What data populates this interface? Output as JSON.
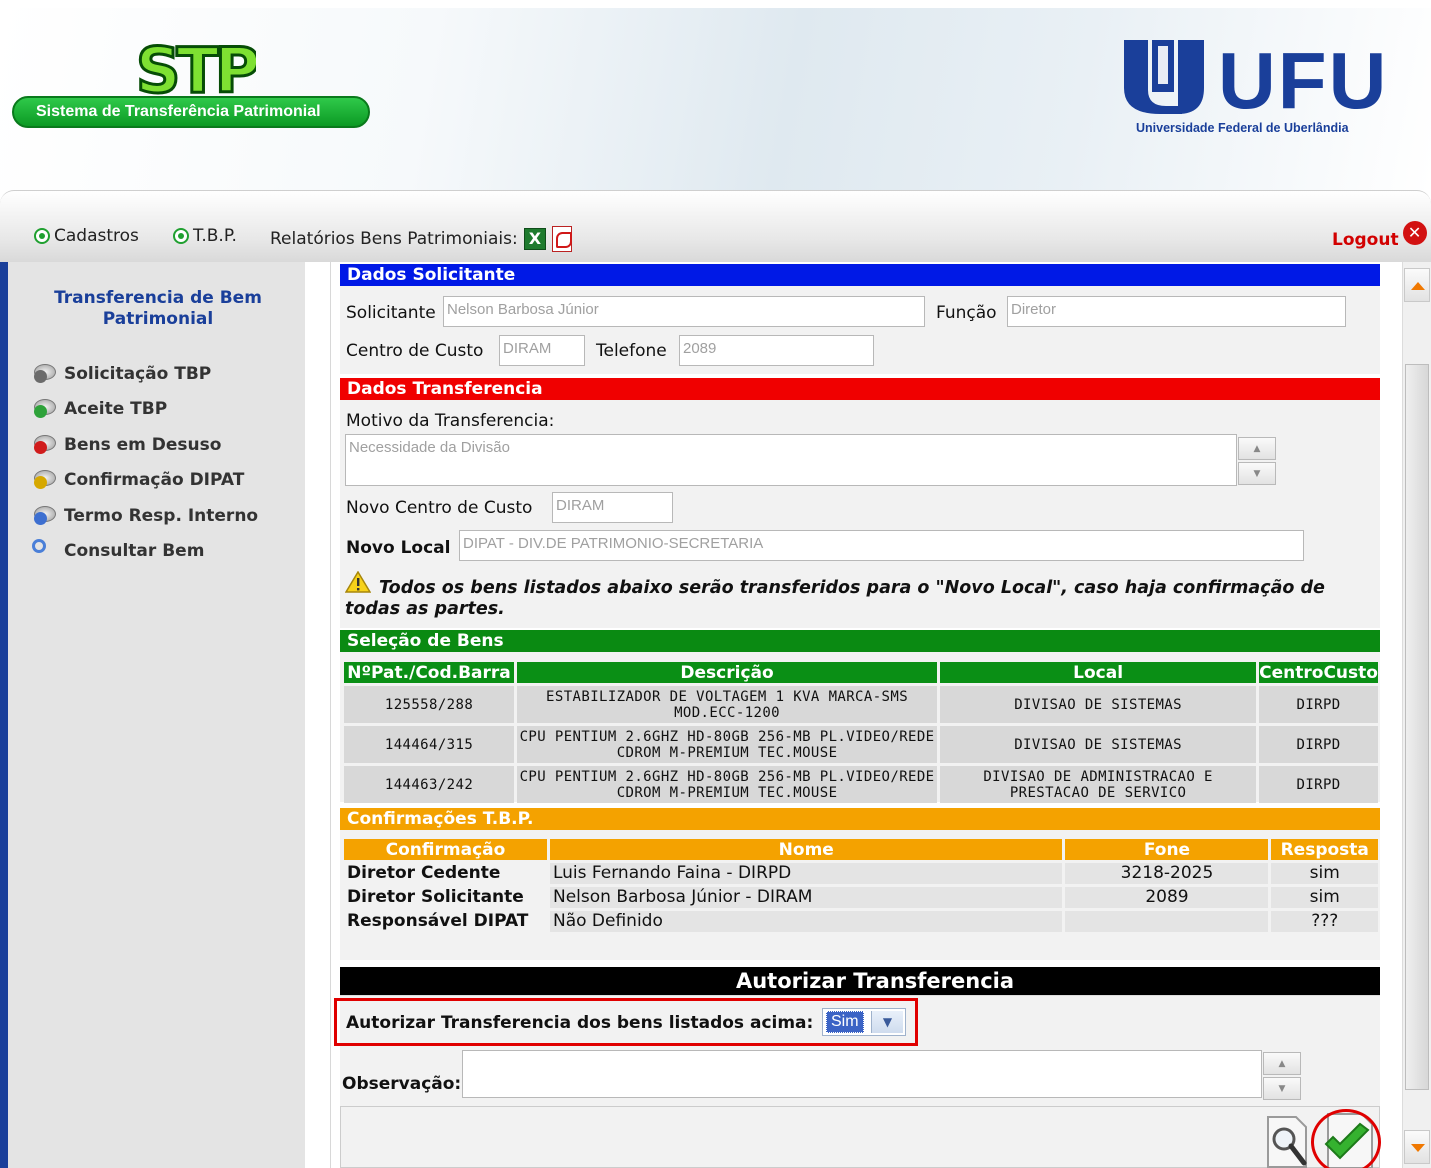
{
  "header": {
    "logo_text": "STP",
    "system_name": "Sistema de Transferência Patrimonial",
    "university_logo_text": "UFU",
    "university_name": "Universidade Federal de Uberlândia"
  },
  "menu": {
    "cadastros": "Cadastros",
    "tbp": "T.B.P.",
    "relatorios": "Relatórios Bens Patrimoniais:",
    "logout": "Logout",
    "icons": [
      "excel-icon",
      "pdf-icon",
      "close-icon"
    ]
  },
  "sidebar": {
    "title": "Transferencia de Bem Patrimonial",
    "items": [
      {
        "label": "Solicitação TBP",
        "badge_color": "#6b6b6b"
      },
      {
        "label": "Aceite TBP",
        "badge_color": "#2ea23a"
      },
      {
        "label": "Bens em Desuso",
        "badge_color": "#d01c1c"
      },
      {
        "label": "Confirmação DIPAT",
        "badge_color": "#d6a800"
      },
      {
        "label": "Termo Resp. Interno",
        "badge_color": "#3d6fd0"
      },
      {
        "label": "Consultar Bem",
        "badge_color": "#4a7fd8"
      }
    ]
  },
  "solicitante": {
    "section_title": "Dados Solicitante",
    "solicitante_label": "Solicitante",
    "solicitante_value": "Nelson Barbosa Júnior",
    "funcao_label": "Função",
    "funcao_value": "Diretor",
    "centro_label": "Centro de Custo",
    "centro_value": "DIRAM",
    "telefone_label": "Telefone",
    "telefone_value": "2089"
  },
  "transferencia": {
    "section_title": "Dados Transferencia",
    "motivo_label": "Motivo da Transferencia:",
    "motivo_value": "Necessidade da Divisão",
    "novo_centro_label": "Novo Centro de Custo",
    "novo_centro_value": "DIRAM",
    "novo_local_label": "Novo Local",
    "novo_local_value": "DIPAT - DIV.DE PATRIMONIO-SECRETARIA",
    "warning": "Todos os bens listados abaixo serão transferidos para o \"Novo Local\", caso haja confirmação de todas as partes."
  },
  "bens": {
    "section_title": "Seleção de Bens",
    "columns": [
      "NºPat./Cod.Barra",
      "Descrição",
      "Local",
      "CentroCusto"
    ],
    "rows": [
      [
        "125558/288",
        "ESTABILIZADOR DE VOLTAGEM 1 KVA MARCA-SMS MOD.ECC-1200",
        "DIVISAO DE SISTEMAS",
        "DIRPD"
      ],
      [
        "144464/315",
        "CPU PENTIUM 2.6GHZ HD-80GB 256-MB PL.VIDEO/REDE CDROM M-PREMIUM TEC.MOUSE",
        "DIVISAO DE SISTEMAS",
        "DIRPD"
      ],
      [
        "144463/242",
        "CPU PENTIUM 2.6GHZ HD-80GB 256-MB PL.VIDEO/REDE CDROM M-PREMIUM TEC.MOUSE",
        "DIVISAO DE ADMINISTRACAO E PRESTACAO DE SERVICO",
        "DIRPD"
      ]
    ]
  },
  "confirmacoes": {
    "section_title": "Confirmações T.B.P.",
    "columns": [
      "Confirmação",
      "Nome",
      "Fone",
      "Resposta"
    ],
    "rows": [
      [
        "Diretor Cedente",
        "Luis Fernando Faina - DIRPD",
        "3218-2025",
        "sim"
      ],
      [
        "Diretor Solicitante",
        "Nelson Barbosa Júnior - DIRAM",
        "2089",
        "sim"
      ],
      [
        "Responsável DIPAT",
        "Não Definido",
        "",
        "???"
      ]
    ]
  },
  "autorizar": {
    "section_title": "Autorizar Transferencia",
    "question": "Autorizar Transferencia dos bens listados acima:",
    "selected": "Sim",
    "obs_label": "Observação:",
    "obs_value": ""
  },
  "colors": {
    "solicitante_bar": "#0019e6",
    "transferencia_bar": "#f00000",
    "bens_bar": "#0a8a12",
    "confirmacoes_bar": "#f4a200",
    "autorizar_bar": "#000000"
  }
}
